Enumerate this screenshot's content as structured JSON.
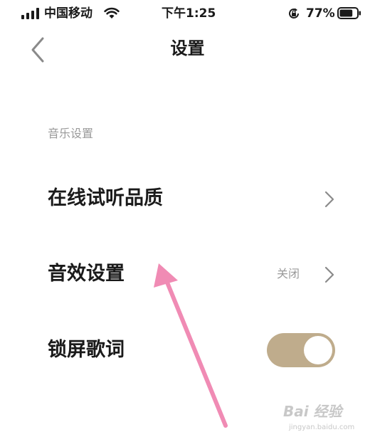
{
  "status_bar": {
    "carrier": "中国移动",
    "time": "下午1:25",
    "battery_percent": "77%",
    "battery_level": 0.77
  },
  "nav": {
    "title": "设置"
  },
  "section": {
    "header": "音乐设置"
  },
  "rows": [
    {
      "label": "在线试听品质"
    },
    {
      "label": "音效设置",
      "value": "关闭"
    },
    {
      "label": "锁屏歌词",
      "toggle_on": true
    }
  ],
  "colors": {
    "toggle_on": "#bfac8c",
    "arrow": "#f08bb4",
    "secondary_text": "#9a9a9a"
  },
  "watermark": {
    "logo": "Bai 经验",
    "url": "jingyan.baidu.com"
  }
}
